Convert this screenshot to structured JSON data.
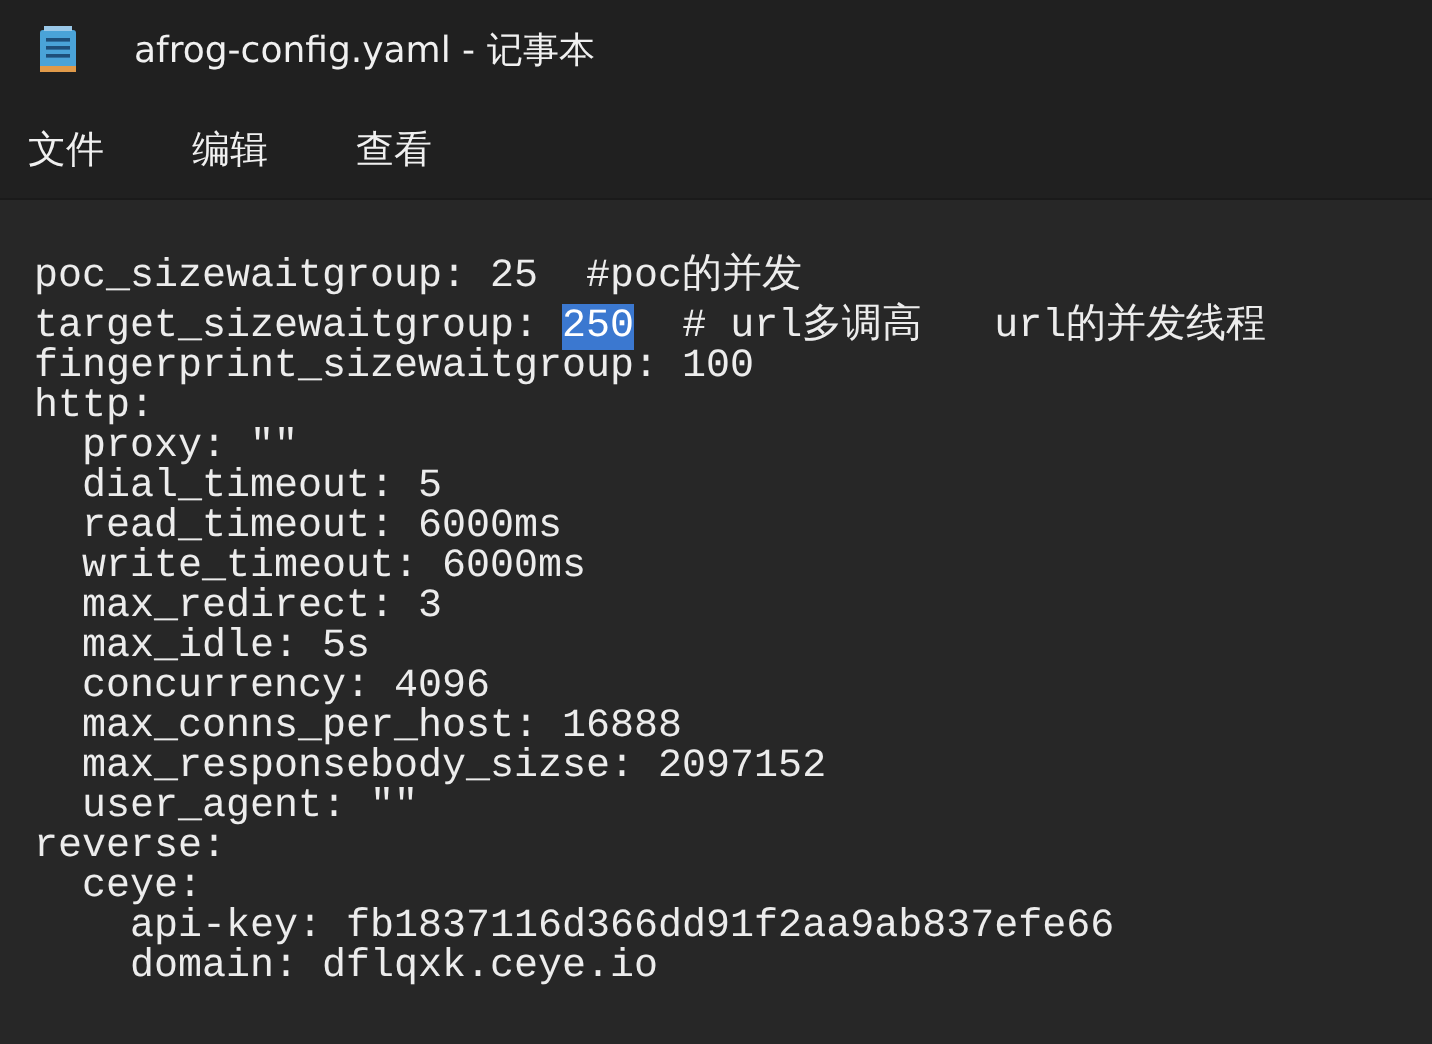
{
  "window": {
    "title": "afrog-config.yaml - 记事本"
  },
  "menu": [
    {
      "label": "文件"
    },
    {
      "label": "编辑"
    },
    {
      "label": "查看"
    }
  ],
  "editor": {
    "lines": [
      [
        {
          "text": "poc_sizewaitgroup: 25  #poc的并发",
          "selected": false
        }
      ],
      [
        {
          "text": "target_sizewaitgroup: ",
          "selected": false
        },
        {
          "text": "250",
          "selected": true
        },
        {
          "text": "  # url多调高   url的并发线程",
          "selected": false
        }
      ],
      [
        {
          "text": "fingerprint_sizewaitgroup: 100",
          "selected": false
        }
      ],
      [
        {
          "text": "http:",
          "selected": false
        }
      ],
      [
        {
          "text": "  proxy: \"\"",
          "selected": false
        }
      ],
      [
        {
          "text": "  dial_timeout: 5",
          "selected": false
        }
      ],
      [
        {
          "text": "  read_timeout: 6000ms",
          "selected": false
        }
      ],
      [
        {
          "text": "  write_timeout: 6000ms",
          "selected": false
        }
      ],
      [
        {
          "text": "  max_redirect: 3",
          "selected": false
        }
      ],
      [
        {
          "text": "  max_idle: 5s",
          "selected": false
        }
      ],
      [
        {
          "text": "  concurrency: 4096",
          "selected": false
        }
      ],
      [
        {
          "text": "  max_conns_per_host: 16888",
          "selected": false
        }
      ],
      [
        {
          "text": "  max_responsebody_sizse: 2097152",
          "selected": false
        }
      ],
      [
        {
          "text": "  user_agent: \"\"",
          "selected": false
        }
      ],
      [
        {
          "text": "reverse:",
          "selected": false
        }
      ],
      [
        {
          "text": "  ceye:",
          "selected": false
        }
      ],
      [
        {
          "text": "    api-key: fb1837116d366dd91f2aa9ab837efe66",
          "selected": false
        }
      ],
      [
        {
          "text": "    domain: dflqxk.ceye.io",
          "selected": false
        }
      ]
    ]
  }
}
